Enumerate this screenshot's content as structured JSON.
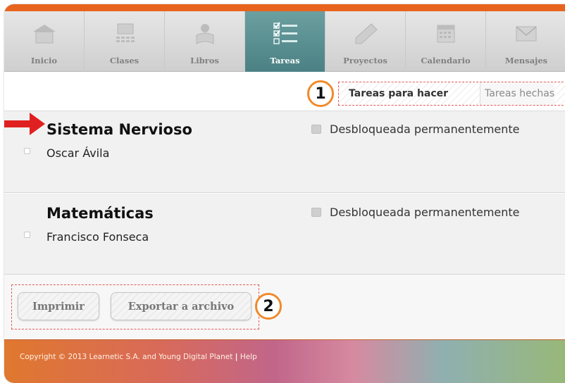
{
  "nav": {
    "items": [
      {
        "label": "Inicio",
        "icon": "home-icon",
        "active": false
      },
      {
        "label": "Clases",
        "icon": "classes-icon",
        "active": false
      },
      {
        "label": "Libros",
        "icon": "books-icon",
        "active": false
      },
      {
        "label": "Tareas",
        "icon": "tasks-icon",
        "active": true
      },
      {
        "label": "Proyectos",
        "icon": "projects-icon",
        "active": false
      },
      {
        "label": "Calendario",
        "icon": "calendar-icon",
        "active": false
      },
      {
        "label": "Mensajes",
        "icon": "mail-icon",
        "active": false
      }
    ]
  },
  "tabs": {
    "todo": "Tareas para hacer",
    "done": "Tareas hechas"
  },
  "callouts": {
    "one": "1",
    "two": "2"
  },
  "tasks": [
    {
      "title": "Sistema Nervioso",
      "owner": "Oscar Ávila",
      "status": "Desbloqueada permanentemente"
    },
    {
      "title": "Matemáticas",
      "owner": "Francisco Fonseca",
      "status": "Desbloqueada permanentemente"
    }
  ],
  "actions": {
    "print": "Imprimir",
    "export": "Exportar a archivo"
  },
  "footer": {
    "copyright": "Copyright © 2013 Learnetic S.A. and Young Digital Planet",
    "separator": "|",
    "help": "Help"
  },
  "colors": {
    "accent_orange": "#e8641e",
    "active_tab": "#5a8f92",
    "highlight_red": "#e02020"
  }
}
